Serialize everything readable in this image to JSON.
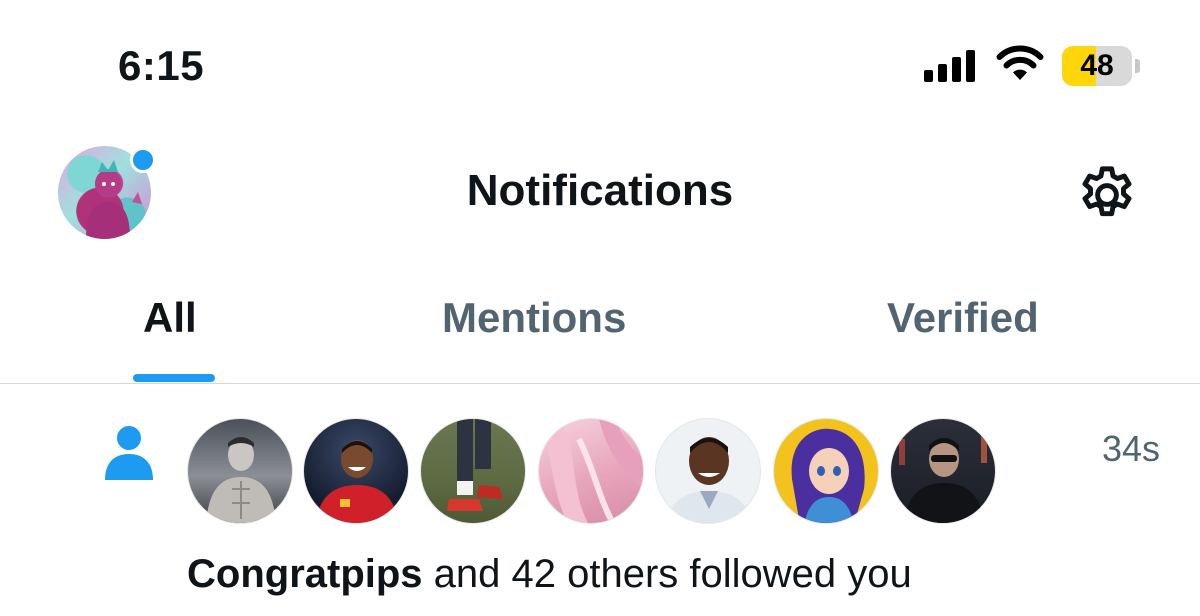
{
  "status_bar": {
    "time": "6:15",
    "signal_icon": "cellular-signal-icon",
    "wifi_icon": "wifi-icon",
    "battery_level": 48,
    "battery_text": "48",
    "battery_fill_color": "#ffd60a"
  },
  "header": {
    "title": "Notifications",
    "avatar_icon": "profile-avatar",
    "notification_dot_color": "#1d9bf0",
    "settings_icon": "gear-icon"
  },
  "tabs": [
    {
      "label": "All",
      "active": true
    },
    {
      "label": "Mentions",
      "active": false
    },
    {
      "label": "Verified",
      "active": false
    }
  ],
  "accent_color": "#1d9bf0",
  "notification": {
    "type_icon": "person-icon",
    "timestamp": "34s",
    "follower_count_avatars": 7,
    "name": "Congratpips",
    "rest_text": " and 42 others followed you"
  }
}
